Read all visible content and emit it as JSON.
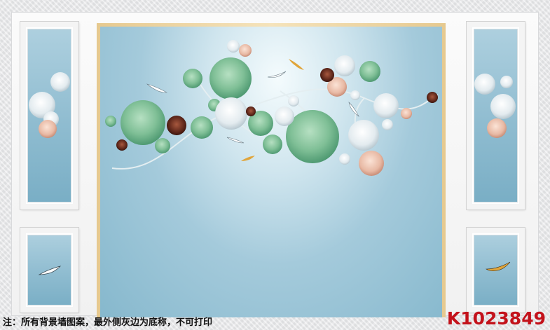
{
  "note": "注：所有背景墙图案，最外侧灰边为底称，不可打印",
  "product_code": "K1023849",
  "colors": {
    "note_text": "#111111",
    "product_code": "#c3121b",
    "panel_blue": "#8fbcd0",
    "gold_frame": "#e6c98f",
    "lotus_leaf": "#7fbf96",
    "white_lotus": "#e8eef2",
    "pink_lotus": "#e8b9a4",
    "dark_lotus": "#5a2418"
  },
  "icons": [
    "lotus-leaf-icon",
    "white-lotus-icon",
    "pink-lotus-icon",
    "dark-lotus-icon",
    "koi-fish-icon"
  ]
}
